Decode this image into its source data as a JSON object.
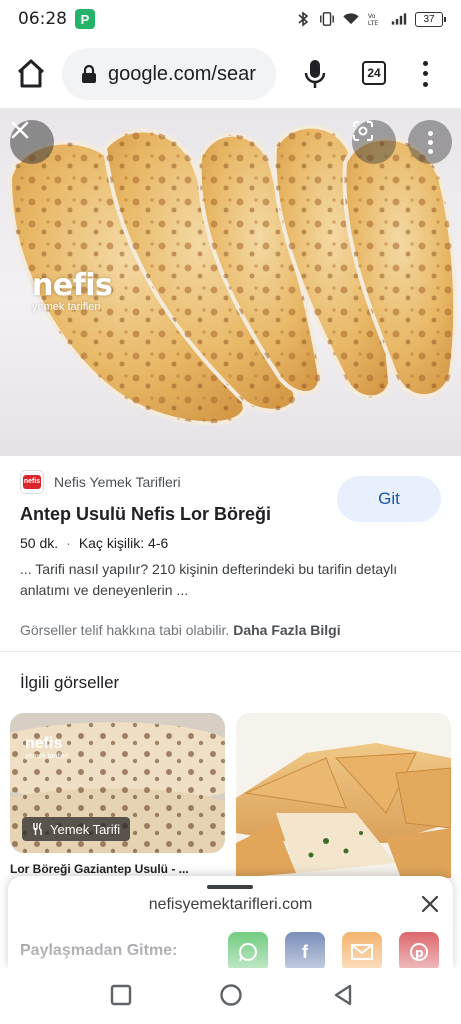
{
  "status_bar": {
    "time": "06:28",
    "app_icon": "P",
    "battery": "37",
    "icons": [
      "bluetooth-icon",
      "vibrate-icon",
      "wifi-icon",
      "volte-icon",
      "signal-icon",
      "battery-icon"
    ]
  },
  "browser": {
    "url": "google.com/sear",
    "tab_count": "24"
  },
  "hero": {
    "watermark_brand": "nefis",
    "watermark_sub": "yemek tarifleri"
  },
  "result": {
    "source_name": "Nefis Yemek Tarifleri",
    "favicon_text": "nefis",
    "visit_label": "Git",
    "title": "Antep Usulü Nefis Lor Böreği",
    "duration": "50 dk.",
    "servings": "Kaç kişilik: 4-6",
    "description": "... Tarifi nasıl yapılır? 210 kişinin defterindeki bu tarifin detaylı anlatımı ve deneyenlerin ...",
    "copyright_text": "Görseller telif hakkına tabi olabilir.",
    "more_info": "Daha Fazla Bilgi"
  },
  "related": {
    "heading": "İlgili görseller",
    "card1_badge": "Yemek Tarifi",
    "card1_caption": "Lor Böreği Gaziantep Usulü - ...",
    "card1_watermark": "nefis",
    "card1_watermark_sub": "yemek tarifleri"
  },
  "sheet": {
    "domain": "nefisyemektarifleri.com",
    "share_label": "Paylaşmadan Gitme:",
    "share_icons": [
      "whatsapp-icon",
      "facebook-icon",
      "mail-icon",
      "pinterest-icon"
    ]
  },
  "colors": {
    "accent": "#1a56a8",
    "button_bg": "#e8f0fe",
    "whatsapp": "#2fb344",
    "facebook": "#3b5998",
    "mail": "#f0902a",
    "pinterest": "#cb2027"
  }
}
